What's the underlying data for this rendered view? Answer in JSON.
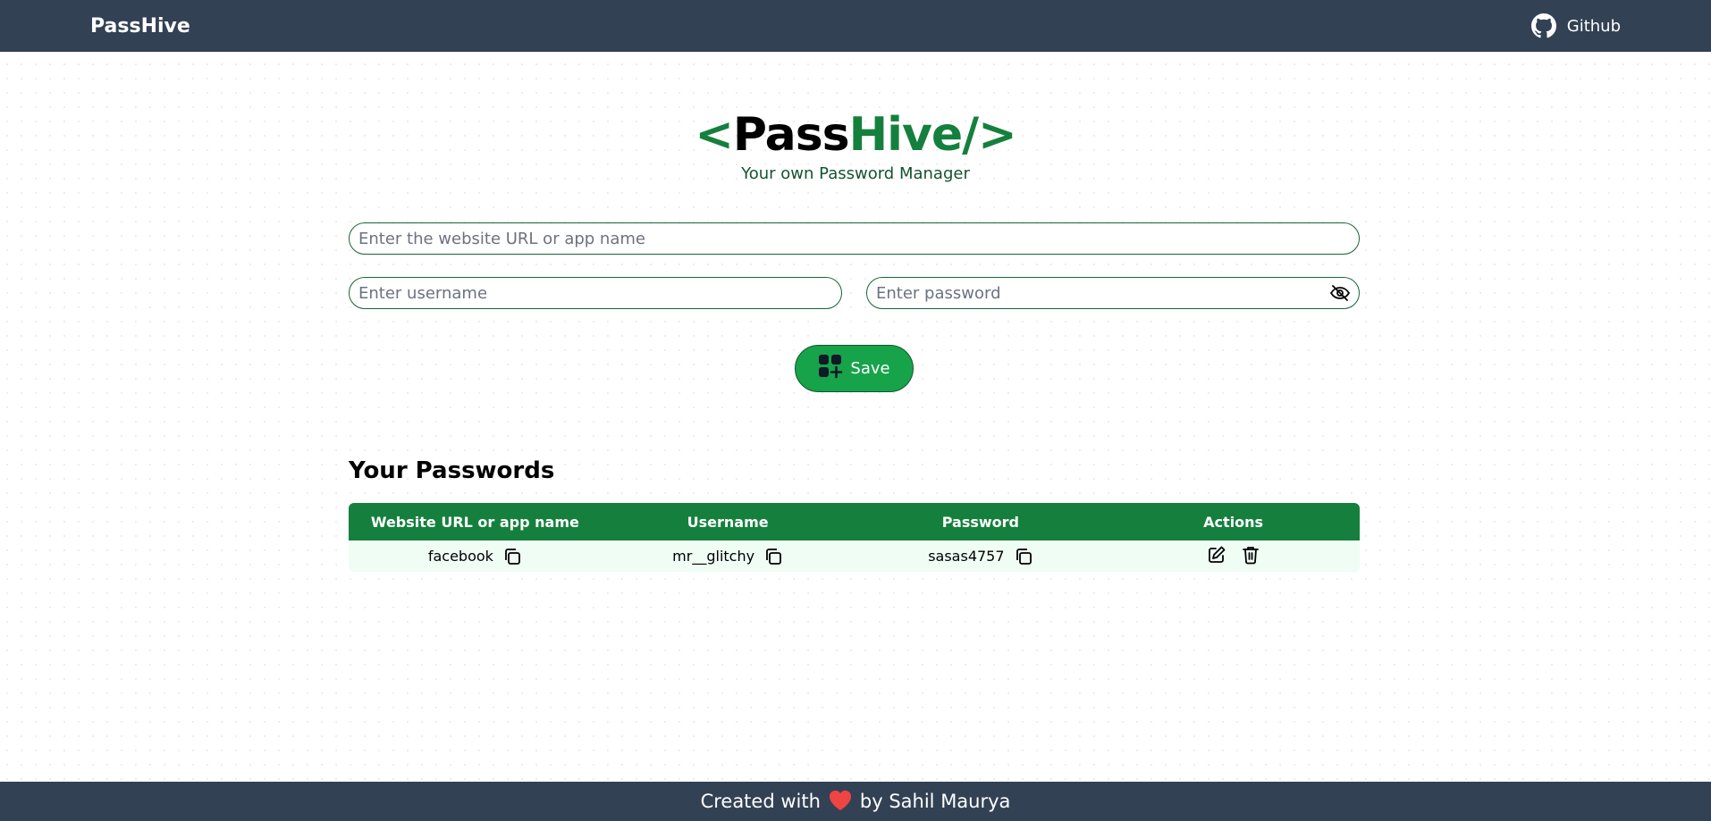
{
  "navbar": {
    "brand": "PassHive",
    "github_label": "Github"
  },
  "hero": {
    "logo_open": "<",
    "logo_pass": "Pass",
    "logo_hive": "Hive/",
    "logo_close": ">",
    "tagline": "Your own Password Manager"
  },
  "form": {
    "site_placeholder": "Enter the website URL or app name",
    "username_placeholder": "Enter username",
    "password_placeholder": "Enter password",
    "save_label": "Save"
  },
  "passwords": {
    "title": "Your Passwords",
    "columns": [
      "Website URL or app name",
      "Username",
      "Password",
      "Actions"
    ],
    "rows": [
      {
        "site": "facebook",
        "username": "mr__glitchy",
        "password": "sasas4757"
      }
    ]
  },
  "footer": {
    "prefix": "Created with",
    "suffix": "by Sahil Maurya"
  },
  "colors": {
    "navbar_bg": "#334155",
    "accent_green": "#15803d",
    "button_green": "#16a34a",
    "row_bg": "#f0fdf4",
    "heart": "#ef4444"
  }
}
